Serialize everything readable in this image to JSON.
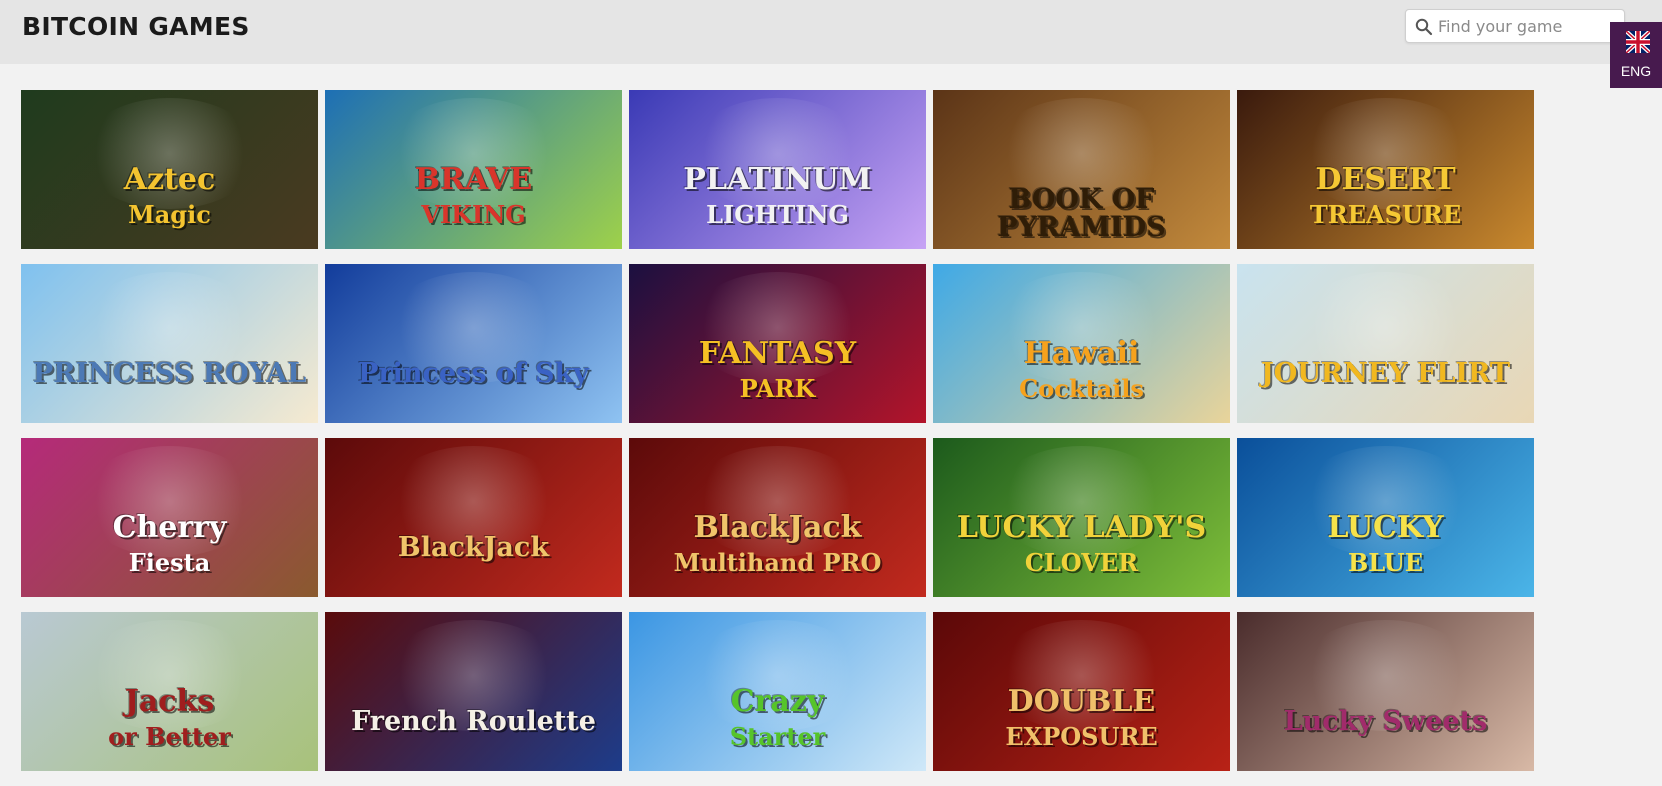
{
  "header": {
    "title": "BITCOIN GAMES",
    "search_placeholder": "Find your game",
    "search_icon": "search-icon",
    "language": {
      "code": "ENG",
      "flag_icon": "uk-flag-icon",
      "background": "#471a4e"
    }
  },
  "games": [
    {
      "id": "aztec-magic",
      "title": "Aztec",
      "title2": "Magic",
      "bg": [
        "#1f3b1e",
        "#4a3a20"
      ],
      "text_color": "#f4c430"
    },
    {
      "id": "brave-viking",
      "title": "BRAVE",
      "title2": "VIKING",
      "bg": [
        "#1d6fb5",
        "#9ed14a"
      ],
      "text_color": "#d9352b"
    },
    {
      "id": "platinum-lighting",
      "title": "PLATINUM",
      "title2": "LIGHTING",
      "bg": [
        "#3a3ab5",
        "#c7a3f5"
      ],
      "text_color": "#f2f2f2"
    },
    {
      "id": "book-of-pyramids",
      "title": "BOOK OF PYRAMIDS",
      "title2": "",
      "bg": [
        "#5b3417",
        "#c38a3c"
      ],
      "text_color": "#2f1d07"
    },
    {
      "id": "desert-treasure",
      "title": "DESERT",
      "title2": "TREASURE",
      "bg": [
        "#3a1a0d",
        "#c9892e"
      ],
      "text_color": "#f5c834"
    },
    {
      "id": "princess-royal",
      "title": "PRINCESS ROYAL",
      "title2": "",
      "bg": [
        "#7fc1ef",
        "#f6ead0"
      ],
      "text_color": "#4c79b5"
    },
    {
      "id": "princess-of-sky",
      "title": "Princess of Sky",
      "title2": "",
      "bg": [
        "#123c9b",
        "#8fc3f2"
      ],
      "text_color": "#3a62c4"
    },
    {
      "id": "fantasy-park",
      "title": "FANTASY",
      "title2": "PARK",
      "bg": [
        "#1b1040",
        "#b3142a"
      ],
      "text_color": "#f5c024"
    },
    {
      "id": "hawaii-cocktails",
      "title": "Hawaii",
      "title2": "Cocktails",
      "bg": [
        "#3fa9e6",
        "#e9d49a"
      ],
      "text_color": "#f6a21d"
    },
    {
      "id": "journey-flirt",
      "title": "JOURNEY FLIRT",
      "title2": "",
      "bg": [
        "#c9e3ef",
        "#e9d7b5"
      ],
      "text_color": "#f1b820"
    },
    {
      "id": "cherry-fiesta",
      "title": "Cherry",
      "title2": "Fiesta",
      "bg": [
        "#b52a7a",
        "#8a5a2e"
      ],
      "text_color": "#ffffff"
    },
    {
      "id": "blackjack",
      "title": "BlackJack",
      "title2": "",
      "bg": [
        "#5c0a0a",
        "#c22a1e"
      ],
      "text_color": "#f0c46a"
    },
    {
      "id": "blackjack-multihand-pro",
      "title": "BlackJack",
      "title2": "Multihand    PRO",
      "bg": [
        "#5c0a0a",
        "#c22a1e"
      ],
      "text_color": "#f0c46a"
    },
    {
      "id": "lucky-ladys-clover",
      "title": "LUCKY LADY'S",
      "title2": "CLOVER",
      "bg": [
        "#1c5a1c",
        "#7fbf3a"
      ],
      "text_color": "#f1d23a"
    },
    {
      "id": "lucky-blue",
      "title": "LUCKY",
      "title2": "BLUE",
      "bg": [
        "#0a4f9a",
        "#4bb5e8"
      ],
      "text_color": "#f6e24a"
    },
    {
      "id": "jacks-or-better",
      "title": "Jacks",
      "title2": "or Better",
      "bg": [
        "#b9c9d3",
        "#a8c27a"
      ],
      "text_color": "#a01e1e"
    },
    {
      "id": "french-roulette",
      "title": "French Roulette",
      "title2": "",
      "bg": [
        "#5a0b0b",
        "#1d3c8a"
      ],
      "text_color": "#f5f0e6"
    },
    {
      "id": "crazy-starter",
      "title": "Crazy",
      "title2": "Starter",
      "bg": [
        "#3b96e3",
        "#cfe8f8"
      ],
      "text_color": "#56c42a"
    },
    {
      "id": "double-exposure",
      "title": "DOUBLE",
      "title2": "EXPOSURE",
      "bg": [
        "#5b0808",
        "#b82216"
      ],
      "text_color": "#f0c06a"
    },
    {
      "id": "lucky-sweets",
      "title": "Lucky Sweets",
      "title2": "",
      "bg": [
        "#4a2c2c",
        "#d8b9a6"
      ],
      "text_color": "#a12b6b"
    }
  ]
}
